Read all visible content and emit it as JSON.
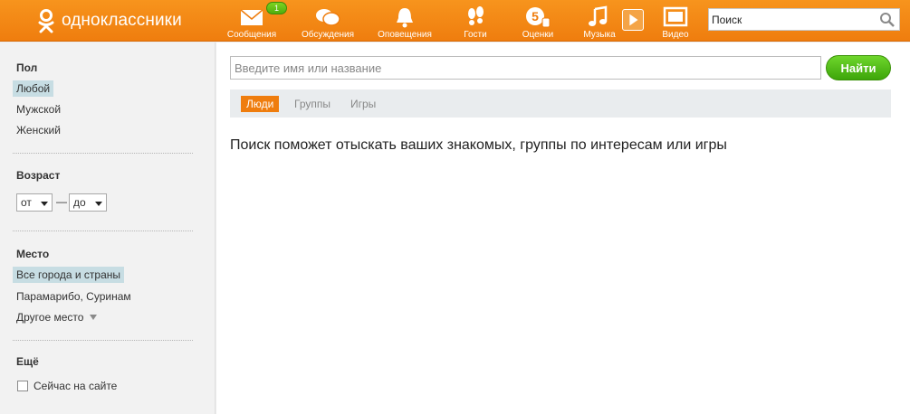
{
  "header": {
    "logo_text": "одноклассники",
    "nav": [
      {
        "id": "messages",
        "label": "Сообщения",
        "icon": "envelope-icon",
        "badge": "1"
      },
      {
        "id": "discussions",
        "label": "Обсуждения",
        "icon": "chat-bubbles-icon"
      },
      {
        "id": "notifications",
        "label": "Оповещения",
        "icon": "bell-icon"
      },
      {
        "id": "guests",
        "label": "Гости",
        "icon": "footprints-icon"
      },
      {
        "id": "ratings",
        "label": "Оценки",
        "icon": "rating-five-icon"
      },
      {
        "id": "music",
        "label": "Музыка",
        "icon": "music-note-icon"
      },
      {
        "id": "video",
        "label": "Видео",
        "icon": "video-icon"
      }
    ],
    "search_placeholder": "Поиск"
  },
  "sidebar": {
    "gender": {
      "title": "Пол",
      "options": [
        "Любой",
        "Мужской",
        "Женский"
      ],
      "selected": "Любой"
    },
    "age": {
      "title": "Возраст",
      "from_label": "от",
      "to_label": "до",
      "dash": "—"
    },
    "place": {
      "title": "Место",
      "options": [
        "Все города и страны",
        "Парамарибо, Суринам",
        "Другое место"
      ],
      "selected": "Все города и страны"
    },
    "more": {
      "title": "Ещё",
      "online_label": "Сейчас на сайте",
      "online_checked": false
    }
  },
  "main": {
    "search_placeholder": "Введите имя или название",
    "search_button": "Найти",
    "tabs": [
      {
        "label": "Люди",
        "active": true
      },
      {
        "label": "Группы",
        "active": false
      },
      {
        "label": "Игры",
        "active": false
      }
    ],
    "hint": "Поиск поможет отыскать ваших знакомых, группы по интересам или игры"
  },
  "colors": {
    "brand_orange": "#ef7d0e",
    "button_green": "#4fae0f",
    "selected_bg": "#c7dde3"
  }
}
